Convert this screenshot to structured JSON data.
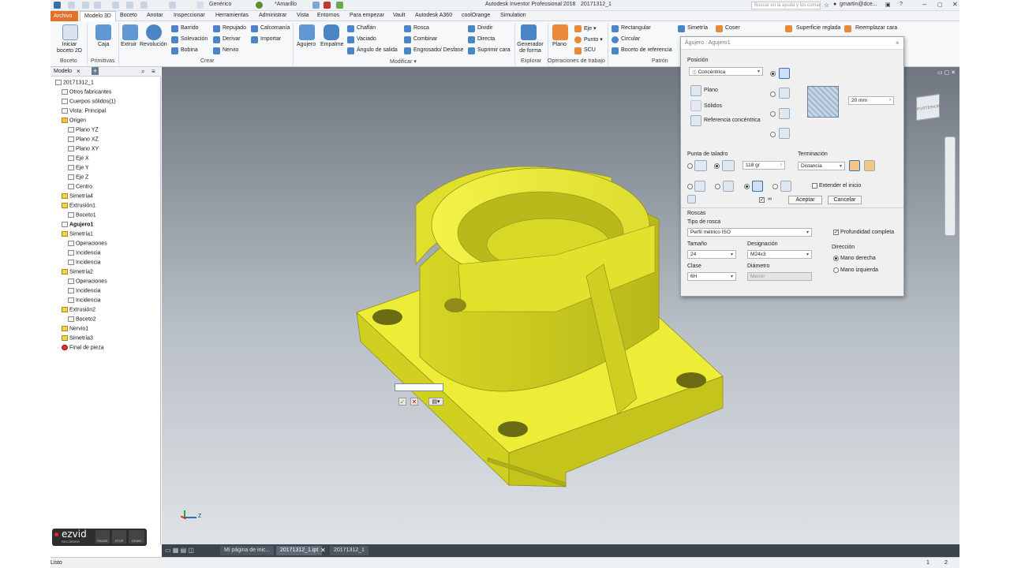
{
  "title_bar": {
    "style": "Genérico",
    "color": "*Amarillo",
    "app_title": "Autodesk Inventor Professional 2018",
    "doc_title": "20171312_1",
    "search_placeholder": "Buscar en la ayuda y los coman",
    "user": "gmartin@dce..."
  },
  "menu": [
    "Archivo",
    "Modelo 3D",
    "Boceto",
    "Anotar",
    "Inspeccionar",
    "Herramientas",
    "Administrar",
    "Vista",
    "Entornos",
    "Para empezar",
    "Vault",
    "Autodesk A360",
    "coolOrange",
    "Simulation"
  ],
  "ribbon": {
    "boceto": {
      "iniciar": "Iniciar boceto 2D",
      "group": "Boceto"
    },
    "primitivas": {
      "caja": "Caja",
      "group": "Primitivas"
    },
    "crear": {
      "extruir": "Extruir",
      "revolucion": "Revolución",
      "barrido": "Barrido",
      "solevacion": "Solevación",
      "bobina": "Bobina",
      "repujado": "Repujado",
      "derivar": "Derivar",
      "nervio": "Nervio",
      "calcomania": "Calcomanía",
      "importar": "Importar",
      "group": "Crear"
    },
    "modificar": {
      "agujero": "Agujero",
      "empalme": "Empalme",
      "chaflan": "Chaflán",
      "vaciado": "Vaciado",
      "angulo": "Ángulo de salida",
      "rosca": "Rosca",
      "combinar": "Combinar",
      "engrosado": "Engrosado/ Desfase",
      "dividir": "Dividir",
      "directa": "Directa",
      "suprimir": "Suprimir cara",
      "group": "Modificar ▾"
    },
    "explorar": {
      "generador": "Generador de forma",
      "group": "Explorar"
    },
    "operaciones": {
      "plano": "Plano",
      "eje": "Eje ▾",
      "punto": "Punto ▾",
      "scu": "SCU",
      "group": "Operaciones de trabajo"
    },
    "patron": {
      "rectangular": "Rectangular",
      "circular": "Circular",
      "boceto_ref": "Boceto de referencia",
      "simetria": "Simetría",
      "coser": "Coser",
      "superficie": "Superficie reglada",
      "reemplazar": "Reemplazar cara",
      "group": "Patrón"
    }
  },
  "browser": {
    "tab": "Modelo",
    "items": [
      {
        "label": "20171312_1",
        "depth": 0
      },
      {
        "label": "Otros fabricantes",
        "depth": 1
      },
      {
        "label": "Cuerpos sólidos(1)",
        "depth": 1
      },
      {
        "label": "Vista: Principal",
        "depth": 1
      },
      {
        "label": "Origen",
        "depth": 1
      },
      {
        "label": "Plano YZ",
        "depth": 2
      },
      {
        "label": "Plano XZ",
        "depth": 2
      },
      {
        "label": "Plano XY",
        "depth": 2
      },
      {
        "label": "Eje X",
        "depth": 2
      },
      {
        "label": "Eje Y",
        "depth": 2
      },
      {
        "label": "Eje Z",
        "depth": 2
      },
      {
        "label": "Centro",
        "depth": 2
      },
      {
        "label": "Simetría4",
        "depth": 1
      },
      {
        "label": "Extrusión1",
        "depth": 1
      },
      {
        "label": "Boceto1",
        "depth": 2
      },
      {
        "label": "Agujero1",
        "depth": 1
      },
      {
        "label": "Simetría1",
        "depth": 1
      },
      {
        "label": "Operaciones",
        "depth": 2
      },
      {
        "label": "Incidencia",
        "depth": 2
      },
      {
        "label": "Incidencia",
        "depth": 2
      },
      {
        "label": "Simetría2",
        "depth": 1
      },
      {
        "label": "Operaciones",
        "depth": 2
      },
      {
        "label": "Incidencia",
        "depth": 2
      },
      {
        "label": "Incidencia",
        "depth": 2
      },
      {
        "label": "Extrusión2",
        "depth": 1
      },
      {
        "label": "Boceto2",
        "depth": 2
      },
      {
        "label": "Nervio1",
        "depth": 1
      },
      {
        "label": "Simetría3",
        "depth": 1
      },
      {
        "label": "Final de pieza",
        "depth": 1
      }
    ]
  },
  "dialog": {
    "title": "Agujero : Agujero1",
    "posicion": "Posición",
    "posicion_value": "Concéntrica",
    "plano": "Plano",
    "solidos": "Sólidos",
    "referencia": "Referencia concéntrica",
    "dim_value": "20 mm",
    "punta": "Punta de taladro",
    "angle": "118 gr",
    "terminacion": "Terminación",
    "terminacion_value": "Distancia",
    "extender": "Extender el inicio",
    "aceptar": "Aceptar",
    "cancelar": "Cancelar",
    "roscas": "Roscas",
    "tipo_rosca": "Tipo de rosca",
    "tipo_value": "Perfil métrico ISO",
    "profundidad": "Profundidad completa",
    "tamano": "Tamaño",
    "tamano_value": "24",
    "designacion": "Designación",
    "designacion_value": "M24x3",
    "direccion": "Dirección",
    "mano_der": "Mano derecha",
    "mano_izq": "Mano izquierda",
    "clase": "Clase",
    "clase_value": "6H",
    "diametro": "Diámetro",
    "diametro_value": "Menor"
  },
  "viewcube": {
    "face": "POSTERIOR"
  },
  "triad": {
    "axis": "Z"
  },
  "recorder": {
    "brand": "ezvid",
    "sub": "RECORDER",
    "pause": "PAUSE",
    "stop": "STOP",
    "draw": "DRAW"
  },
  "doc_tabs": [
    "Mi página de inic...",
    "20171312_1.ipt",
    "20171312_1"
  ],
  "status": {
    "text": "Listo",
    "n1": "1",
    "n2": "2"
  },
  "colors": {
    "part": "#e6e626",
    "accent": "#e0722a"
  }
}
